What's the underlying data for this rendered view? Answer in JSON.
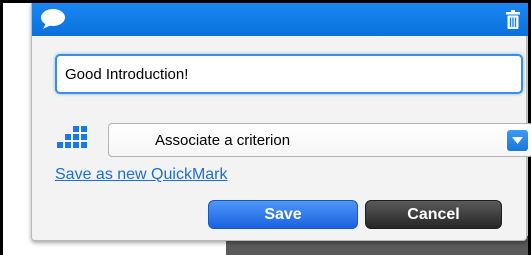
{
  "header": {
    "icon_left": "speech-bubble-icon",
    "icon_right": "trash-icon",
    "color": "#0a7ae6"
  },
  "comment": {
    "value": "Good Introduction!"
  },
  "criterion": {
    "icon": "grid-icon",
    "selected": "Associate a criterion"
  },
  "quickmark_link": "Save as new QuickMark",
  "buttons": {
    "save": "Save",
    "cancel": "Cancel"
  },
  "colors": {
    "accent": "#1a86f2",
    "link": "#1a6fd6",
    "save_button": "#2f7af0",
    "cancel_button": "#3a3a3a"
  }
}
